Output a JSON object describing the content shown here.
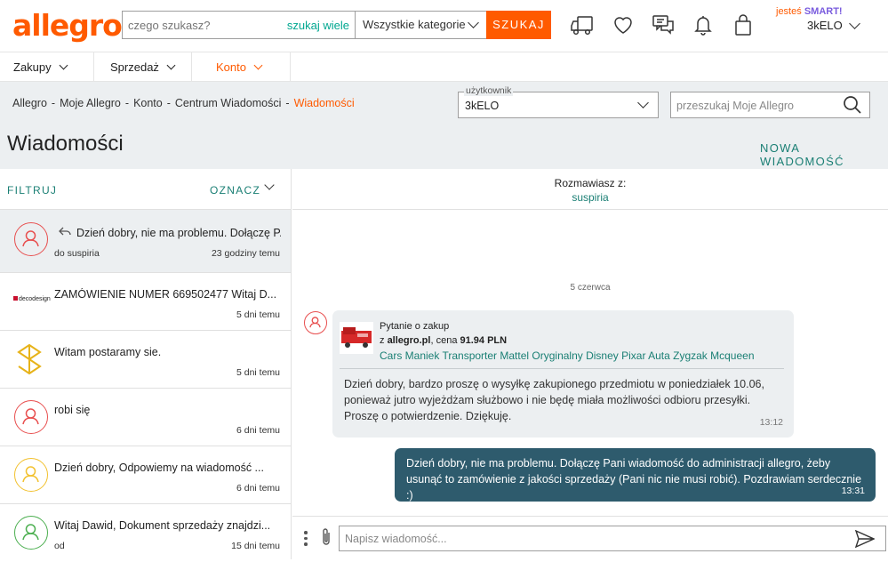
{
  "header": {
    "logo": "allegro",
    "search_placeholder": "czego szukasz?",
    "search_many": "szukaj wiele",
    "category": "Wszystkie kategorie",
    "search_button": "SZUKAJ",
    "smart_prefix": "jesteś",
    "smart_label": "SMART!",
    "user": "3kELO"
  },
  "nav": {
    "items": [
      "Zakupy",
      "Sprzedaż",
      "Konto"
    ],
    "active": "Konto"
  },
  "breadcrumb": [
    "Allegro",
    "Moje Allegro",
    "Konto",
    "Centrum Wiadomości",
    "Wiadomości"
  ],
  "user_select": {
    "label": "użytkownik",
    "value": "3kELO"
  },
  "my_search_placeholder": "przeszukaj Moje Allegro",
  "page_title": "Wiadomości",
  "new_message": "NOWA WIADOMOŚĆ",
  "list": {
    "filter": "FILTRUJ",
    "mark": "OZNACZ",
    "conversations": [
      {
        "title": "Dzień dobry, nie ma problemu. Dołączę P...",
        "sub": "do suspiria",
        "time": "23 godziny temu",
        "avatar": "person",
        "color": "#e84f4f",
        "reply": true
      },
      {
        "title": "ZAMÓWIENIE NUMER 669502477 Witaj D...",
        "sub": "",
        "time": "5 dni temu",
        "avatar": "decodesign",
        "color": "#c8102e"
      },
      {
        "title": "Witam postaramy sie.",
        "sub": "",
        "time": "5 dni temu",
        "avatar": "logo-s",
        "color": "#e7b31a"
      },
      {
        "title": "robi się",
        "sub": "",
        "time": "6 dni temu",
        "avatar": "person",
        "color": "#e84f4f"
      },
      {
        "title": "Dzień dobry, Odpowiemy na wiadomość ...",
        "sub": "",
        "time": "6 dni temu",
        "avatar": "person",
        "color": "#f2c12e"
      },
      {
        "title": "Witaj Dawid, Dokument sprzedaży znajdzi...",
        "sub": "od",
        "time": "15 dni temu",
        "avatar": "person",
        "color": "#4caf50"
      }
    ]
  },
  "conversation": {
    "with_label": "Rozmawiasz z:",
    "with_name": "suspiria",
    "date": "5 czerwca",
    "product": {
      "question": "Pytanie o zakup",
      "from_prefix": "z",
      "site": "allegro.pl",
      "price_label": ", cena",
      "price": "91.94 PLN",
      "title": "Cars Maniek Transporter Mattel Oryginalny Disney Pixar Auta Zygzak Mcqueen"
    },
    "incoming": {
      "text": "Dzień dobry, bardzo proszę o wysyłkę zakupionego przedmiotu w poniedziałek 10.06, ponieważ jutro wyjeżdżam służbowo i nie będę miała możliwości odbioru przesyłki. Proszę o potwierdzenie. Dziękuję.",
      "time": "13:12"
    },
    "outgoing": {
      "text": "Dzień dobry, nie ma problemu. Dołączę Pani wiadomość do administracji allegro, żeby usunąć to zamówienie z jakości sprzedaży (Pani nic nie musi robić). Pozdrawiam serdecznie :)",
      "time": "13:31"
    },
    "compose_placeholder": "Napisz wiadomość..."
  },
  "colors": {
    "brand": "#ff5a00",
    "teal": "#1a7f74",
    "own_bubble": "#2e5b6d",
    "bg_grey": "#eceff1"
  }
}
